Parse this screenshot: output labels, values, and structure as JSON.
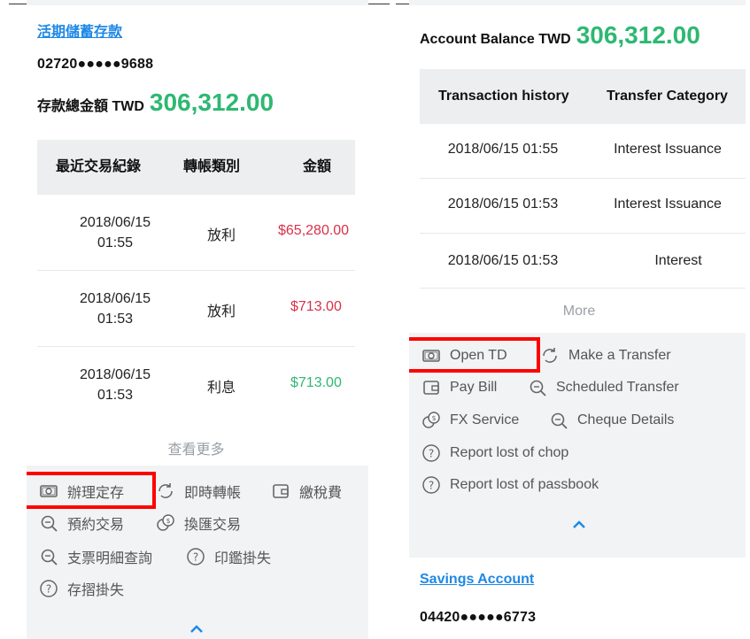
{
  "left": {
    "account_name": "活期儲蓄存款",
    "account_number": "02720●●●●●9688",
    "balance_label": "存款總金額 TWD",
    "balance_value": "306,312.00",
    "table_headers": [
      "最近交易紀錄",
      "轉帳類別",
      "金額"
    ],
    "rows": [
      {
        "date": "2018/06/15",
        "time": "01:55",
        "category": "放利",
        "amount": "$65,280.00",
        "amount_color": "red"
      },
      {
        "date": "2018/06/15",
        "time": "01:53",
        "category": "放利",
        "amount": "$713.00",
        "amount_color": "red"
      },
      {
        "date": "2018/06/15",
        "time": "01:53",
        "category": "利息",
        "amount": "$713.00",
        "amount_color": "green"
      }
    ],
    "more": "查看更多",
    "actions": {
      "open_td": "辦理定存",
      "transfer": "即時轉帳",
      "pay_tax": "繳稅費",
      "scheduled": "預約交易",
      "fx": "換匯交易",
      "cheque": "支票明細查詢",
      "chop": "印鑑掛失",
      "passbook": "存摺掛失"
    }
  },
  "right": {
    "balance_label": "Account Balance TWD",
    "balance_value": "306,312.00",
    "table_headers": [
      "Transaction history",
      "Transfer Category"
    ],
    "rows": [
      {
        "datetime": "2018/06/15 01:55",
        "category": "Interest Issuance"
      },
      {
        "datetime": "2018/06/15 01:53",
        "category": "Interest Issuance"
      },
      {
        "datetime": "2018/06/15 01:53",
        "category": "Interest"
      }
    ],
    "more": "More",
    "actions": {
      "open_td": "Open TD",
      "transfer": "Make a Transfer",
      "pay_bill": "Pay Bill",
      "scheduled": "Scheduled Transfer",
      "fx": "FX Service",
      "cheque": "Cheque Details",
      "chop": "Report lost of chop",
      "passbook": "Report lost of passbook"
    },
    "savings_account_name": "Savings Account",
    "savings_account_number": "04420●●●●●6773"
  },
  "colors": {
    "accent_blue": "#1e88e5",
    "balance_green": "#2eb872",
    "amount_red": "#d9304a",
    "highlight_red": "#ff0000"
  }
}
